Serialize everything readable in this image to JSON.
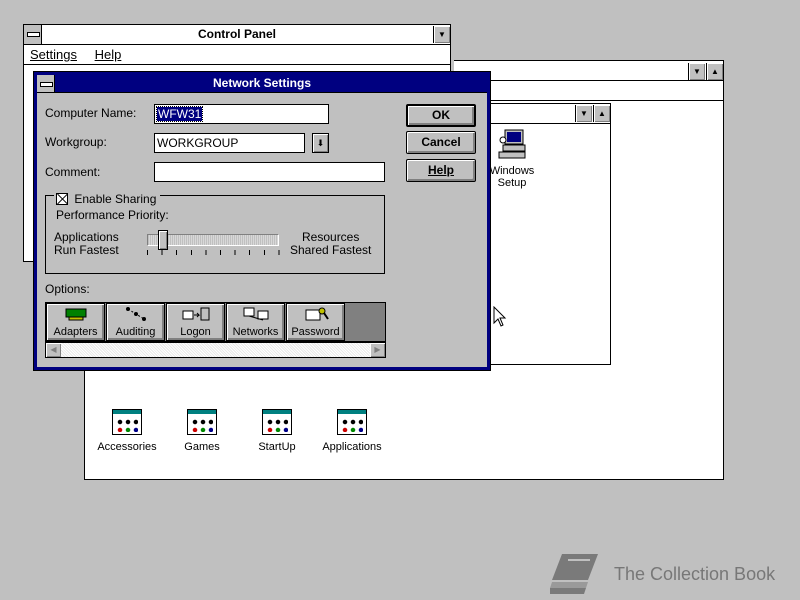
{
  "control_panel": {
    "title": "Control Panel",
    "menu": [
      "Settings",
      "Help"
    ]
  },
  "program_manager": {
    "groups": [
      "Accessories",
      "Games",
      "StartUp",
      "Applications"
    ]
  },
  "main_group": {
    "windows_setup_label_1": "Windows",
    "windows_setup_label_2": "Setup"
  },
  "dialog": {
    "title": "Network Settings",
    "computer_name_label": "Computer Name:",
    "computer_name_value": "WFW31",
    "workgroup_label": "Workgroup:",
    "workgroup_value": "WORKGROUP",
    "comment_label": "Comment:",
    "comment_value": "",
    "enable_sharing_label": "Enable Sharing",
    "enable_sharing_checked": true,
    "performance_label": "Performance Priority:",
    "left_label_1": "Applications",
    "left_label_2": "Run Fastest",
    "right_label_1": "Resources",
    "right_label_2": "Shared Fastest",
    "slider_value": 0.1,
    "options_label": "Options:",
    "ok_label": "OK",
    "cancel_label": "Cancel",
    "help_label": "Help",
    "options": [
      {
        "label": "Adapters",
        "icon": "network-card-icon"
      },
      {
        "label": "Auditing",
        "icon": "auditing-icon"
      },
      {
        "label": "Logon",
        "icon": "logon-icon"
      },
      {
        "label": "Networks",
        "icon": "networks-icon"
      },
      {
        "label": "Password",
        "icon": "password-key-icon"
      }
    ]
  },
  "watermark": {
    "text": "The Collection Book"
  },
  "colors": {
    "desktop": "#c0c0c0",
    "active_title": "#000080",
    "selection": "#000080"
  }
}
